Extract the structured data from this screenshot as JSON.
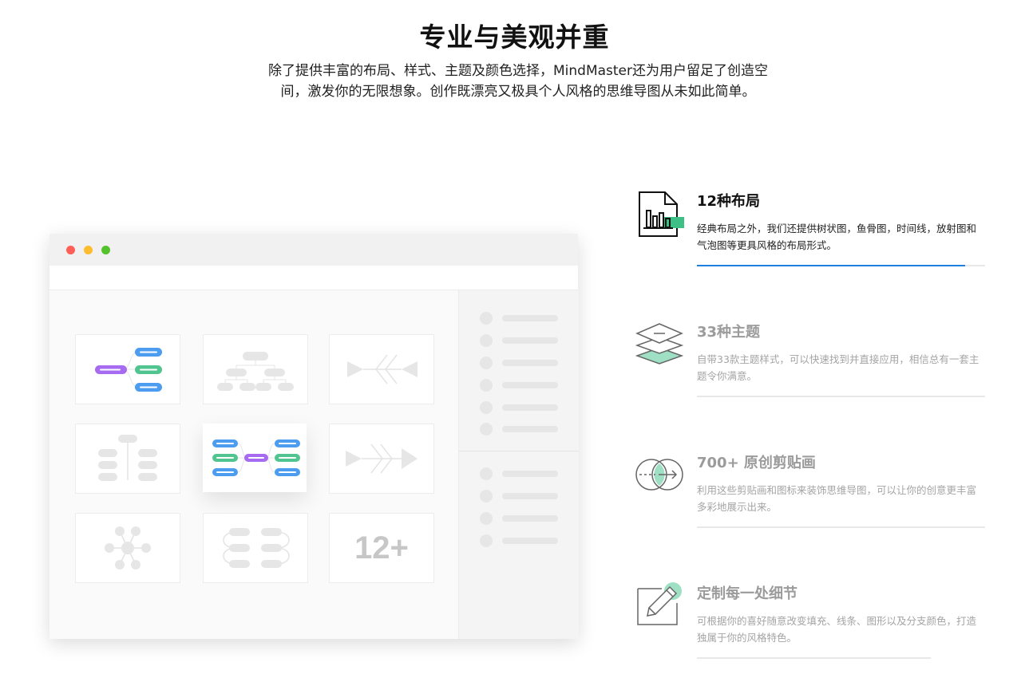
{
  "hero": {
    "title": "专业与美观并重",
    "subtitle": "除了提供丰富的布局、样式、主题及颜色选择，MindMaster还为用户留足了创造空间，激发你的无限想象。创作既漂亮又极具个人风格的思维导图从未如此简单。"
  },
  "window": {
    "controls": [
      "close-dot",
      "minimize-dot",
      "maximize-dot"
    ],
    "control_colors": [
      "#ff5f57",
      "#febc2e",
      "#53c22b"
    ],
    "more_layouts_label": "12+"
  },
  "features": [
    {
      "title": "12种布局",
      "desc": "经典布局之外，我们还提供树状图，鱼骨图，时间线，放射图和气泡图等更具风格的布局形式。",
      "icon": "chart-document-icon",
      "active": true,
      "progress": 0.93
    },
    {
      "title": "33种主题",
      "desc": "自带33款主题样式，可以快速找到并直接应用，相信总有一套主题令你满意。",
      "icon": "layers-icon",
      "active": false
    },
    {
      "title": "700+ 原创剪贴画",
      "desc": "利用这些剪贴画和图标来装饰思维导图，可以让你的创意更丰富多彩地展示出来。",
      "icon": "overlap-circles-icon",
      "active": false
    },
    {
      "title": "定制每一处细节",
      "desc": "可根据你的喜好随意改变填充、线条、图形以及分支颜色，打造独属于你的风格特色。",
      "icon": "edit-pencil-icon",
      "active": false
    }
  ],
  "colors": {
    "accent_blue": "#1f7fe0",
    "accent_green": "#3dbf86",
    "node_purple": "#a66bf0",
    "node_blue": "#4c9cf0",
    "node_green": "#52c48f",
    "muted_gray": "#9b9b9b"
  }
}
